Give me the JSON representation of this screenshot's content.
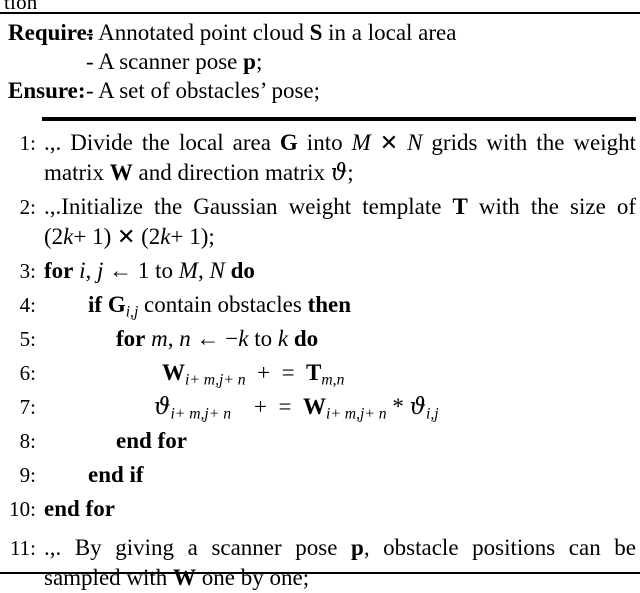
{
  "figure": {
    "clipped_caption": "tion",
    "io": [
      {
        "label": "Require:",
        "text": "- Annotated point cloud S in a local area"
      },
      {
        "label": "",
        "text": "- A scanner pose p;"
      },
      {
        "label": "Ensure:",
        "text": "- A set of obstacles’ pose;"
      }
    ],
    "steps": [
      {
        "num": "1:",
        "text": ".,. Divide the local area G into M × N grids with the weight matrix W and direction matrix ϑ;"
      },
      {
        "num": "2:",
        "text": ".,. Initialize the Gaussian weight template T with the size of (2k + 1) × (2k + 1);"
      },
      {
        "num": "3:",
        "text": "for i, j ← 1 to M, N do"
      },
      {
        "num": "4:",
        "text": "if G_{i,j} contain obstacles then"
      },
      {
        "num": "5:",
        "text": "for m, n ← −k to k do"
      },
      {
        "num": "6:",
        "text": "W_{i+m,j+n} + = T_{m,n}"
      },
      {
        "num": "7:",
        "text": "ϑ_{i+m,j+n} + = W_{i+m,j+n} * ϑ_{i,j}"
      },
      {
        "num": "8:",
        "text": "end for"
      },
      {
        "num": "9:",
        "text": "end if"
      },
      {
        "num": "10:",
        "text": "end for"
      },
      {
        "num": "11:",
        "text": ".,. By giving a scanner pose p, obstacle positions can be sampled with W one by one;"
      }
    ]
  }
}
